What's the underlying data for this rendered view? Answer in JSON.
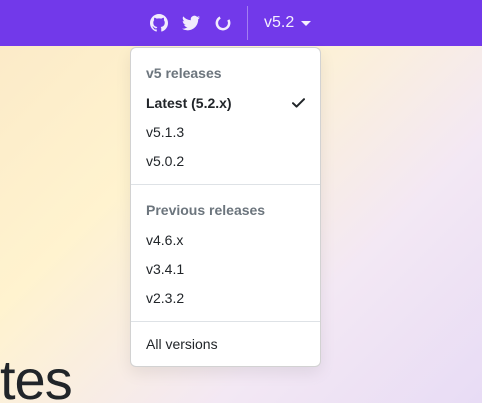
{
  "navbar": {
    "color": "#7239ea",
    "icons": [
      "github-icon",
      "twitter-icon",
      "opencollective-icon"
    ],
    "version_label": "v5.2"
  },
  "hero": {
    "text": "tes"
  },
  "dropdown": {
    "groups": [
      {
        "header": "v5 releases",
        "items": [
          {
            "label": "Latest (5.2.x)",
            "active": true
          },
          {
            "label": "v5.1.3",
            "active": false
          },
          {
            "label": "v5.0.2",
            "active": false
          }
        ]
      },
      {
        "header": "Previous releases",
        "items": [
          {
            "label": "v4.6.x",
            "active": false
          },
          {
            "label": "v3.4.1",
            "active": false
          },
          {
            "label": "v2.3.2",
            "active": false
          }
        ]
      }
    ],
    "all_versions_label": "All versions"
  }
}
